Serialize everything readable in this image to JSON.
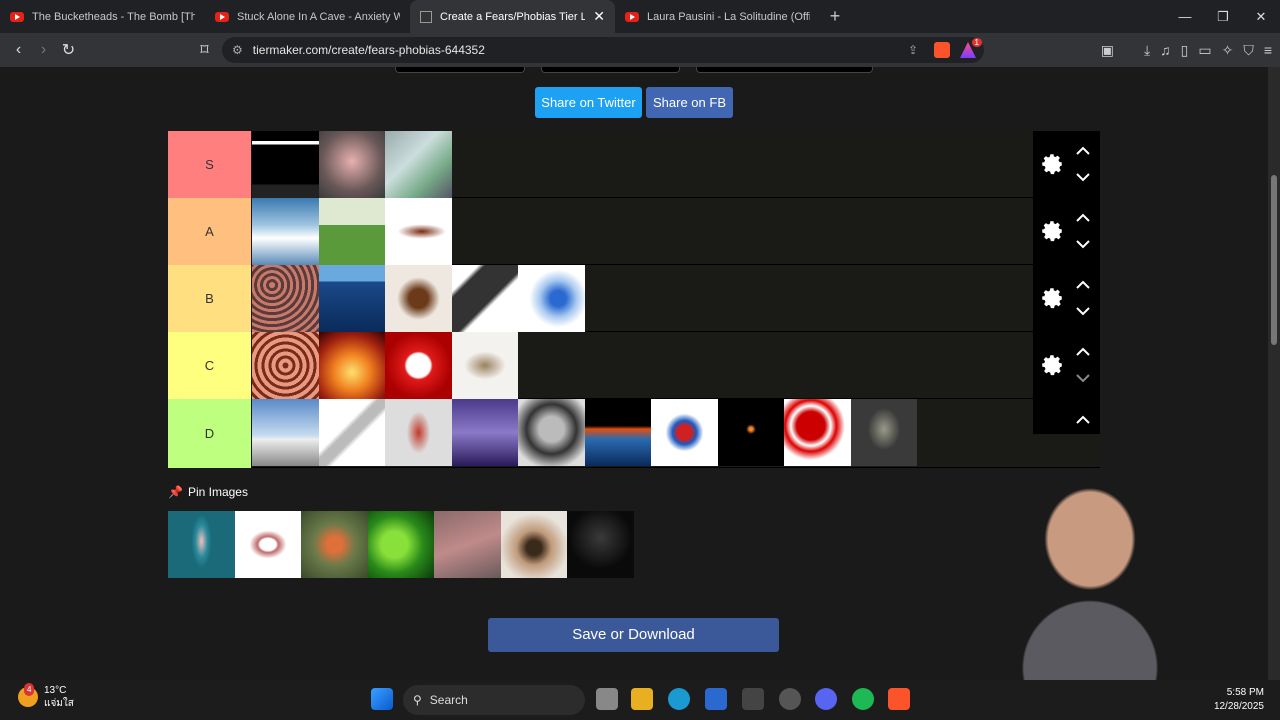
{
  "browser": {
    "tabs": [
      {
        "title": "The Bucketheads - The Bomb [These",
        "type": "youtube"
      },
      {
        "title": "Stuck Alone In A Cave - Anxiety Warn",
        "type": "youtube"
      },
      {
        "title": "Create a Fears/Phobias Tier List",
        "type": "tiermaker",
        "active": true
      },
      {
        "title": "Laura Pausini - La Solitudine (Official",
        "type": "youtube"
      }
    ],
    "url": "tiermaker.com/create/fears-phobias-644352",
    "brave_badge": "1"
  },
  "share": {
    "twitter_label": "Share on Twitter",
    "fb_label": "Share on FB"
  },
  "tiers": [
    {
      "label": "S",
      "color": "#ff7f7f",
      "item_count": 3
    },
    {
      "label": "A",
      "color": "#ffbf7f",
      "item_count": 3
    },
    {
      "label": "B",
      "color": "#ffdf7f",
      "item_count": 5
    },
    {
      "label": "C",
      "color": "#ffff7f",
      "item_count": 4
    },
    {
      "label": "D",
      "color": "#bfff7f",
      "item_count": 10
    }
  ],
  "pin_images_label": "Pin Images",
  "pool_item_count": 7,
  "save_label": "Save or Download",
  "colors": {
    "twitter": "#1da1f2",
    "facebook": "#4267b2",
    "save": "#3b5998",
    "page_bg": "#1a1a1a"
  },
  "taskbar": {
    "weather_temp": "13°C",
    "weather_desc": "แจ่มใส",
    "weather_badge": "4",
    "search_label": "Search",
    "time": "5:58 PM",
    "date": "12/28/2025"
  }
}
